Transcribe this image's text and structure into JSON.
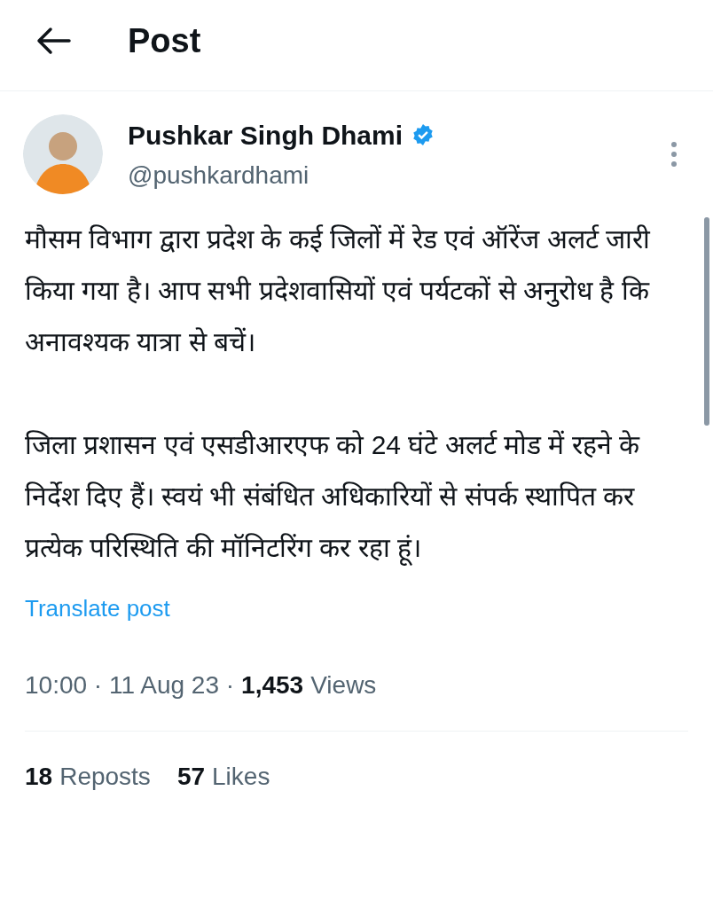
{
  "header": {
    "title": "Post"
  },
  "author": {
    "name": "Pushkar Singh Dhami",
    "handle": "@pushkardhami",
    "verified": true
  },
  "paragraphs": [
    "मौसम विभाग द्वारा प्रदेश के कई जिलों में रेड एवं ऑरेंज अलर्ट जारी किया गया है। आप सभी प्रदेशवासियों एवं पर्यटकों से अनुरोध है कि अनावश्यक यात्रा से बचें।",
    "जिला प्रशासन एवं एसडीआरएफ को 24 घंटे अलर्ट मोड में रहने के निर्देश दिए हैं। स्वयं भी संबंधित अधिकारियों से संपर्क स्थापित कर प्रत्येक परिस्थिति की मॉनिटरिंग कर रहा हूं।"
  ],
  "translate_link": "Translate post",
  "meta": {
    "timestamp": "10:00 · 11 Aug 23 ·",
    "views_count": "1,453",
    "views_label": "Views"
  },
  "stats": [
    {
      "count": "18",
      "label": "Reposts"
    },
    {
      "count": "57",
      "label": "Likes"
    }
  ]
}
